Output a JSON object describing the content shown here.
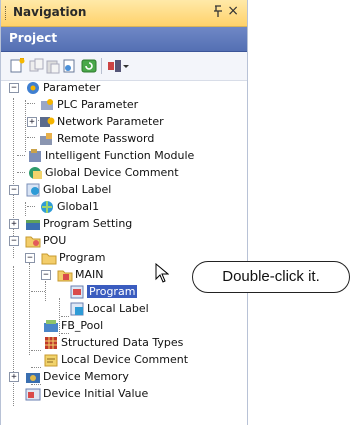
{
  "header": {
    "title": "Navigation",
    "pin_glyph": "p̈",
    "close_glyph": "×"
  },
  "project": {
    "label": "Project"
  },
  "toolbar": {
    "icons": [
      "new-item-icon",
      "copy-icon",
      "paste-icon",
      "properties-icon",
      "refresh-icon",
      "filter-dropdown-icon"
    ]
  },
  "tree": {
    "parameter": "Parameter",
    "plc_parameter": "PLC Parameter",
    "network_parameter": "Network Parameter",
    "remote_password": "Remote Password",
    "intelligent_function_module": "Intelligent Function Module",
    "global_device_comment": "Global Device Comment",
    "global_label": "Global Label",
    "global1": "Global1",
    "program_setting": "Program Setting",
    "pou": "POU",
    "program_folder": "Program",
    "main": "MAIN",
    "program_item": "Program",
    "local_label": "Local Label",
    "fb_pool": "FB_Pool",
    "structured_data_types": "Structured Data Types",
    "local_device_comment": "Local Device Comment",
    "device_memory": "Device Memory",
    "device_initial_value": "Device Initial Value"
  },
  "callout": {
    "text": "Double-click it."
  },
  "colors": {
    "header_bg": "#ffd26b",
    "project_bar": "#5470b3",
    "selection": "#3a5cbf"
  }
}
